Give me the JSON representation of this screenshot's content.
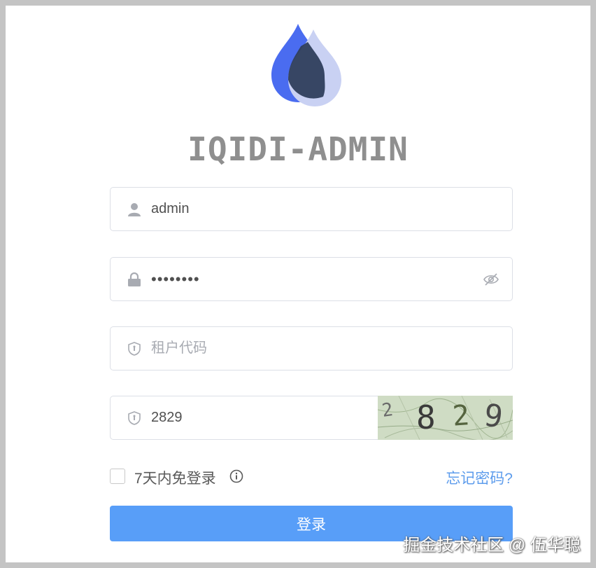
{
  "app": {
    "title": "IQIDI-ADMIN"
  },
  "username": {
    "value": "admin"
  },
  "password": {
    "value": "••••••••"
  },
  "tenant": {
    "placeholder": "租户代码"
  },
  "captcha": {
    "value": "2829",
    "image_text": [
      "2",
      "8",
      "2",
      "9"
    ]
  },
  "options": {
    "remember_label": "7天内免登录",
    "forgot_label": "忘记密码?"
  },
  "login": {
    "label": "登录"
  },
  "watermark": "掘金技术社区 @ 伍华聪",
  "colors": {
    "primary": "#589ef8",
    "link": "#5d9cec",
    "logo_blue": "#4a6cf0",
    "logo_dark": "#2f3e5c"
  },
  "icons": {
    "user": "user-icon",
    "lock": "lock-icon",
    "eye": "eye-slash-icon",
    "shield": "shield-icon",
    "info": "info-icon"
  }
}
